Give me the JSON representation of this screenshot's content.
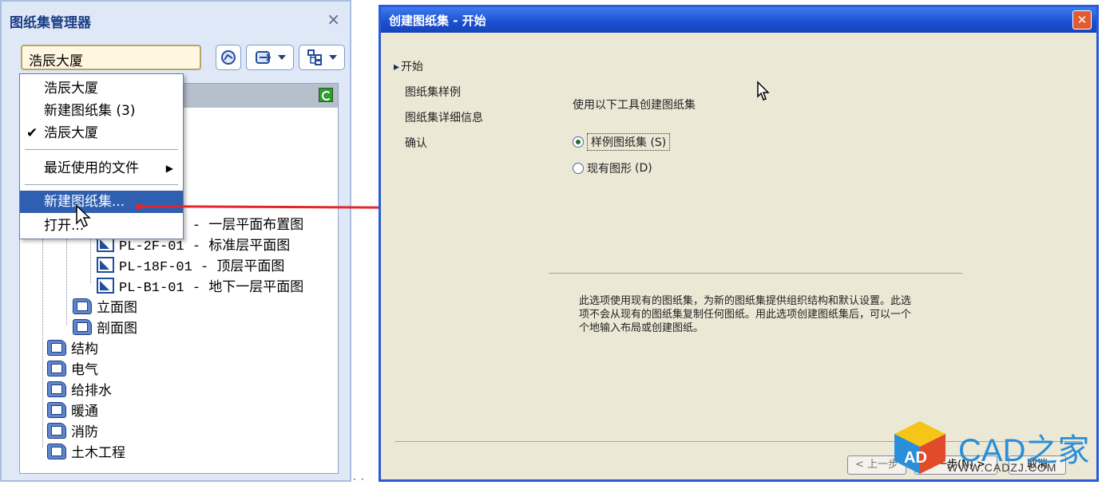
{
  "ssm": {
    "title": "图纸集管理器",
    "close": "×",
    "combo_value": "浩辰大厦",
    "tree": [
      {
        "label": "PL-1F-01  -  一层平面布置图",
        "kind": "sheet"
      },
      {
        "label": "PL-2F-01  -  标准层平面图",
        "kind": "sheet"
      },
      {
        "label": "PL-18F-01  -  顶层平面图",
        "kind": "sheet"
      },
      {
        "label": "PL-B1-01  -  地下一层平面图",
        "kind": "sheet"
      },
      {
        "label": "立面图",
        "kind": "set"
      },
      {
        "label": "剖面图",
        "kind": "set"
      },
      {
        "label": "结构",
        "kind": "set"
      },
      {
        "label": "电气",
        "kind": "set"
      },
      {
        "label": "给排水",
        "kind": "set"
      },
      {
        "label": "暖通",
        "kind": "set"
      },
      {
        "label": "消防",
        "kind": "set"
      },
      {
        "label": "土木工程",
        "kind": "set"
      }
    ]
  },
  "menu": {
    "items": [
      {
        "label": "浩辰大厦"
      },
      {
        "label": "新建图纸集  (3)"
      },
      {
        "label": "浩辰大厦",
        "check": "✔"
      },
      {
        "label": "最近使用的文件",
        "sub": "▶"
      },
      {
        "label": "新建图纸集...",
        "selected": true
      },
      {
        "label": "打开..."
      }
    ]
  },
  "dialog": {
    "title": "创建图纸集 - 开始",
    "close": "✕",
    "steps": [
      "开始",
      "图纸集样例",
      "图纸集详细信息",
      "确认"
    ],
    "intro": "使用以下工具创建图纸集",
    "options": [
      {
        "label": "样例图纸集",
        "key": "(S)",
        "selected": true
      },
      {
        "label": "现有图形",
        "key": "(D)",
        "selected": false
      }
    ],
    "description": "此选项使用现有的图纸集，为新的图纸集提供组织结构和默认设置。此选项不会从现有的图纸集复制任何图纸。用此选项创建图纸集后，可以一个个地输入布局或创建图纸。",
    "buttons": {
      "back": "< 上一步",
      "next": "下一步(N) >",
      "cancel": "取消"
    }
  },
  "watermark": {
    "name": "CAD之家",
    "url": "WWW.CADZJ.COM",
    "cube_letters": "AD"
  },
  "colors": {
    "accent": "#2a5bd6",
    "arrow": "#e3262b",
    "menu_highlight": "#2f5fb0"
  }
}
